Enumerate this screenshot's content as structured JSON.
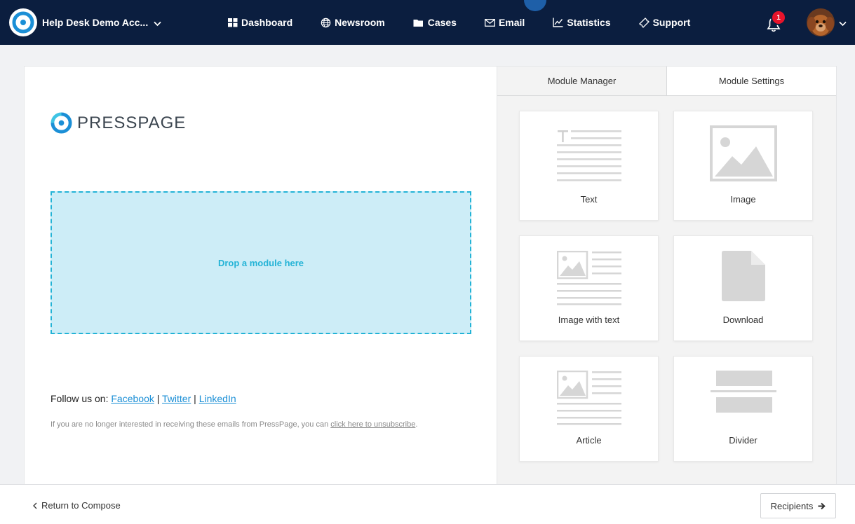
{
  "nav": {
    "account": "Help Desk Demo Acc...",
    "items": [
      {
        "label": "Dashboard",
        "icon": "grid-icon"
      },
      {
        "label": "Newsroom",
        "icon": "globe-icon"
      },
      {
        "label": "Cases",
        "icon": "folder-icon"
      },
      {
        "label": "Email",
        "icon": "envelope-icon"
      },
      {
        "label": "Statistics",
        "icon": "line-chart-icon"
      },
      {
        "label": "Support",
        "icon": "ticket-icon"
      }
    ],
    "notifications": "1"
  },
  "email": {
    "logo_text": "PRESSPAGE",
    "dropzone": "Drop a module here",
    "follow_label": "Follow us on:",
    "social": [
      "Facebook",
      "Twitter",
      "LinkedIn"
    ],
    "separator": "|",
    "unsubscribe_text": "If you are no longer interested in receiving these emails from PressPage, you can",
    "unsubscribe_link": "click here to unsubscribe",
    "unsubscribe_end": "."
  },
  "panel": {
    "tabs": [
      "Module Manager",
      "Module Settings"
    ],
    "modules": [
      "Text",
      "Image",
      "Image with text",
      "Download",
      "Article",
      "Divider"
    ]
  },
  "footer": {
    "back": "Return to Compose",
    "next": "Recipients"
  },
  "colors": {
    "nav_bg": "#0b1e3f",
    "accent": "#23b3d6",
    "link": "#1b8fd6",
    "badge": "#e8142b"
  }
}
